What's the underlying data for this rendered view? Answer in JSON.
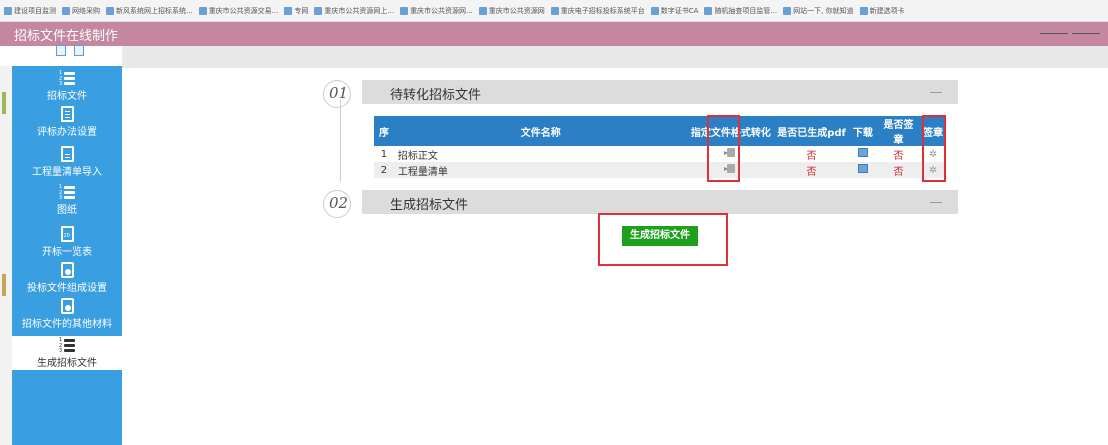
{
  "bookmarks": [
    "建设项目监测",
    "网络采购",
    "新风系统网上招标系统...",
    "重庆市公共资源交易...",
    "专网",
    "重庆市公共资源网上...",
    "重庆市公共资源网...",
    "重庆市公共资源网",
    "重庆电子招标投标系统平台",
    "数字证书CA",
    "随机抽查项目监管...",
    "网站一下, 你就知道",
    "新建选项卡"
  ],
  "app": {
    "title": "招标文件在线制作"
  },
  "sidebar": {
    "items": [
      {
        "label": "招标文件",
        "icon": "numbered-list-icon"
      },
      {
        "label": "评标办法设置",
        "icon": "document-icon"
      },
      {
        "label": "工程量清单导入",
        "icon": "document-icon"
      },
      {
        "label": "图纸",
        "icon": "numbered-list-icon"
      },
      {
        "label": "开标一览表",
        "icon": "page-icon"
      },
      {
        "label": "投标文件组成设置",
        "icon": "case-icon"
      },
      {
        "label": "招标文件的其他材料",
        "icon": "case-icon"
      },
      {
        "label": "生成招标文件",
        "icon": "numbered-list-icon",
        "active": true
      }
    ]
  },
  "sections": [
    {
      "number": "01",
      "title": "待转化招标文件"
    },
    {
      "number": "02",
      "title": "生成招标文件"
    }
  ],
  "table": {
    "headers": [
      "序",
      "文件名称",
      "指定文件格式转化",
      "是否已生成pdf",
      "下载",
      "是否签章",
      "签章"
    ],
    "rows": [
      {
        "index": "1",
        "name": "招标正文",
        "pdf": "否",
        "signed": "否"
      },
      {
        "index": "2",
        "name": "工程量清单",
        "pdf": "否",
        "signed": "否"
      }
    ]
  },
  "actions": {
    "generate_label": "生成招标文件"
  },
  "colors": {
    "titlebar": "#c4879f",
    "sidebar": "#3a9fe0",
    "table_header": "#2b7fc4",
    "generate_button": "#1ea01e",
    "no_text": "#d2232a",
    "highlight_box": "#e0303a"
  }
}
